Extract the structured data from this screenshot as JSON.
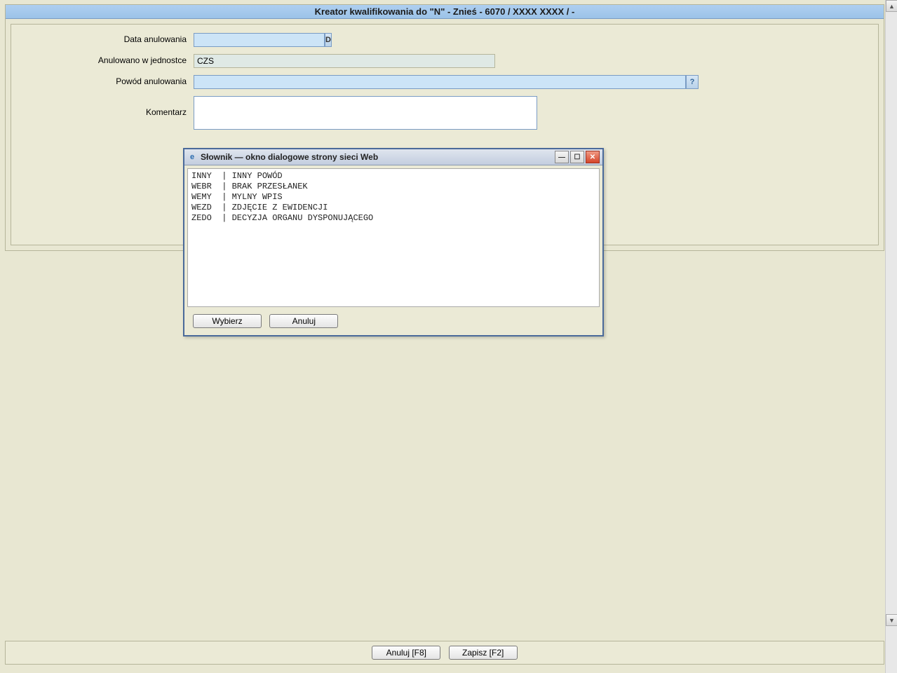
{
  "title": "Kreator kwalifikowania do \"N\" - Znieś - 6070 / XXXX XXXX / -",
  "form": {
    "labels": {
      "date": "Data anulowania",
      "unit": "Anulowano w jednostce",
      "reason": "Powód anulowania",
      "comment": "Komentarz"
    },
    "date_value": "",
    "date_button": "D",
    "unit_value": "CZS",
    "reason_value": "",
    "help_button": "?",
    "comment_value": ""
  },
  "bottom": {
    "cancel": "Anuluj [F8]",
    "save": "Zapisz [F2]"
  },
  "dialog": {
    "title": "Słownik — okno dialogowe strony sieci Web",
    "items": [
      {
        "code": "INNY",
        "label": "INNY POWÓD"
      },
      {
        "code": "WEBR",
        "label": "BRAK PRZESŁANEK"
      },
      {
        "code": "WEMY",
        "label": "MYLNY WPIS"
      },
      {
        "code": "WEZD",
        "label": "ZDJĘCIE Z EWIDENCJI"
      },
      {
        "code": "ZEDO",
        "label": "DECYZJA ORGANU DYSPONUJĄCEGO"
      }
    ],
    "buttons": {
      "select": "Wybierz",
      "cancel": "Anuluj"
    }
  }
}
